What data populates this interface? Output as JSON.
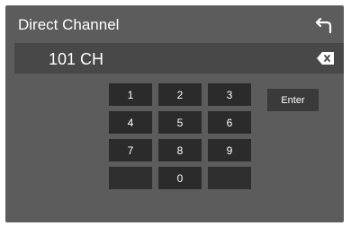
{
  "header": {
    "title": "Direct Channel",
    "back_icon": "return-arrow-icon"
  },
  "display": {
    "value": "101 CH",
    "backspace_icon": "backspace-icon"
  },
  "keypad": {
    "keys": [
      "1",
      "2",
      "3",
      "4",
      "5",
      "6",
      "7",
      "8",
      "9",
      "0"
    ],
    "enter_label": "Enter"
  },
  "colors": {
    "screen_bg": "#5c5c5c",
    "display_bg": "#484848",
    "key_bg": "#2b2b2b",
    "text": "#ffffff"
  }
}
